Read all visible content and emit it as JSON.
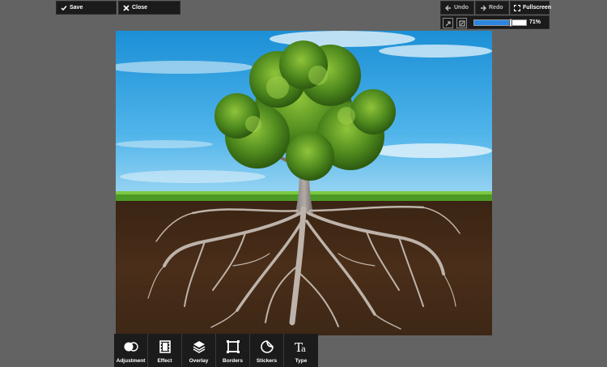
{
  "topbar": {
    "save_label": "Save",
    "close_label": "Close",
    "undo_label": "Undo",
    "redo_label": "Redo",
    "fullscreen_label": "Fullscreen"
  },
  "zoom": {
    "label": "71%",
    "level": 0.71
  },
  "toolbar": {
    "items": [
      {
        "label": "Adjustment",
        "icon": "adjustment-icon"
      },
      {
        "label": "Effect",
        "icon": "film-icon"
      },
      {
        "label": "Overlay",
        "icon": "layers-icon"
      },
      {
        "label": "Borders",
        "icon": "frame-icon"
      },
      {
        "label": "Stickers",
        "icon": "sticker-icon"
      },
      {
        "label": "Type",
        "icon": "type-icon"
      }
    ]
  },
  "colors": {
    "background": "#636363",
    "panel": "#1b1b1b",
    "accent": "#2a86e0"
  }
}
